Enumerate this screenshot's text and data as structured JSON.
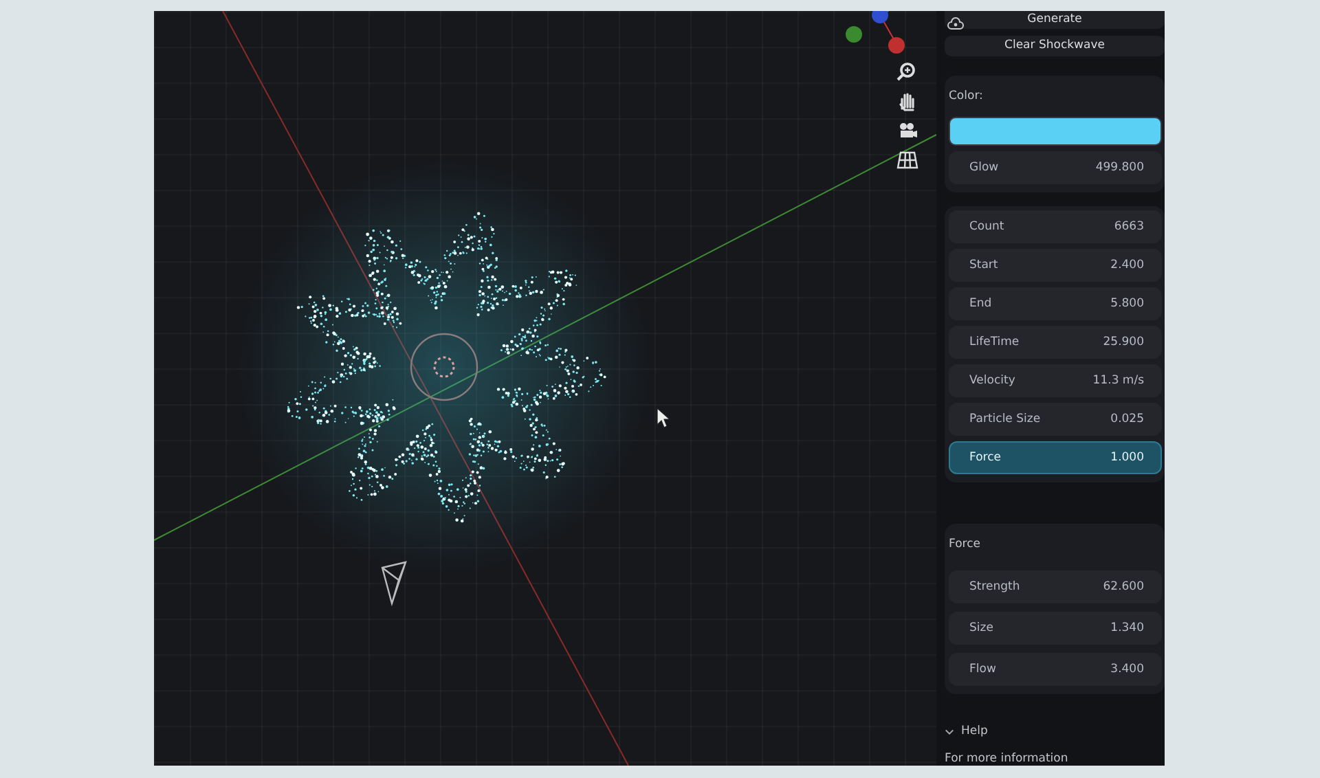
{
  "viewport": {
    "tools": [
      {
        "kind": "zoom"
      },
      {
        "kind": "pan"
      },
      {
        "kind": "camera"
      },
      {
        "kind": "grid"
      }
    ]
  },
  "panel": {
    "generate": "Generate",
    "clear": "Clear Shockwave",
    "color": {
      "label": "Color:",
      "color": "#5bd0f5",
      "glow": {
        "label": "Glow",
        "value": "499.800"
      }
    },
    "params": [
      {
        "label": "Count",
        "value": "6663",
        "selected": false
      },
      {
        "label": "Start",
        "value": "2.400",
        "selected": false
      },
      {
        "label": "End",
        "value": "5.800",
        "selected": false
      },
      {
        "label": "LifeTime",
        "value": "25.900",
        "selected": false
      },
      {
        "label": "Velocity",
        "value": "11.3 m/s",
        "selected": false
      },
      {
        "label": "Particle Size",
        "value": "0.025",
        "selected": false
      },
      {
        "label": "Force",
        "value": "1.000",
        "selected": true
      }
    ],
    "force": {
      "title": "Force",
      "fields": [
        {
          "label": "Strength",
          "value": "62.600"
        },
        {
          "label": "Size",
          "value": "1.340"
        },
        {
          "label": "Flow",
          "value": "3.400"
        }
      ]
    },
    "help": {
      "title": "Help",
      "expanded": true,
      "text": "For more information"
    }
  }
}
